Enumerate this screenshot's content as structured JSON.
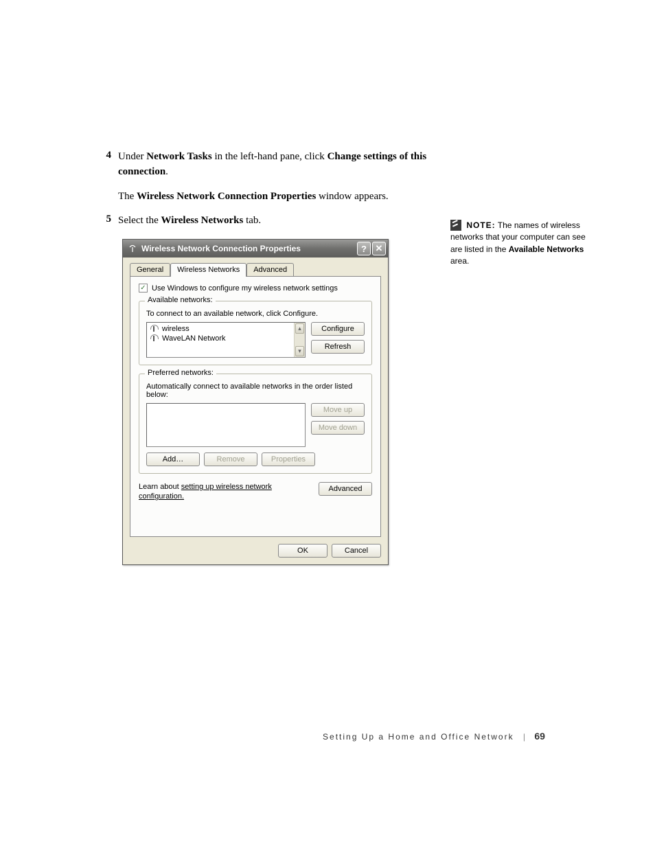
{
  "steps": {
    "s4": {
      "num": "4",
      "pre": "Under ",
      "b1": "Network Tasks",
      "mid": " in the left-hand pane, click ",
      "b2": "Change settings of this connection",
      "post": ".",
      "result_pre": "The ",
      "result_b": "Wireless Network Connection Properties",
      "result_post": " window appears."
    },
    "s5": {
      "num": "5",
      "pre": "Select the ",
      "b1": "Wireless Networks",
      "post": " tab."
    }
  },
  "note": {
    "label": "NOTE:",
    "body_pre": " The names of wireless networks that your computer can see are listed in the ",
    "body_b": "Available Networks",
    "body_post": " area."
  },
  "dialog": {
    "title": "Wireless Network Connection Properties",
    "help": "?",
    "close": "✕",
    "tabs": {
      "general": "General",
      "wireless": "Wireless Networks",
      "advanced": "Advanced"
    },
    "checkbox": {
      "mark": "✓",
      "label": "Use Windows to configure my wireless network settings"
    },
    "available": {
      "legend": "Available networks:",
      "desc": "To connect to an available network, click Configure.",
      "items": [
        "wireless",
        "WaveLAN Network"
      ],
      "configure": "Configure",
      "refresh": "Refresh",
      "scroll_up": "▴",
      "scroll_down": "▾"
    },
    "preferred": {
      "legend": "Preferred networks:",
      "desc": "Automatically connect to available networks in the order listed below:",
      "moveup": "Move up",
      "movedown": "Move down",
      "add": "Add…",
      "remove": "Remove",
      "properties": "Properties"
    },
    "learn": {
      "pre": "Learn about ",
      "link": "setting up wireless network configuration.",
      "advanced": "Advanced"
    },
    "ok": "OK",
    "cancel": "Cancel"
  },
  "footer": {
    "title": "Setting Up a Home and Office Network",
    "sep": "|",
    "page": "69"
  }
}
